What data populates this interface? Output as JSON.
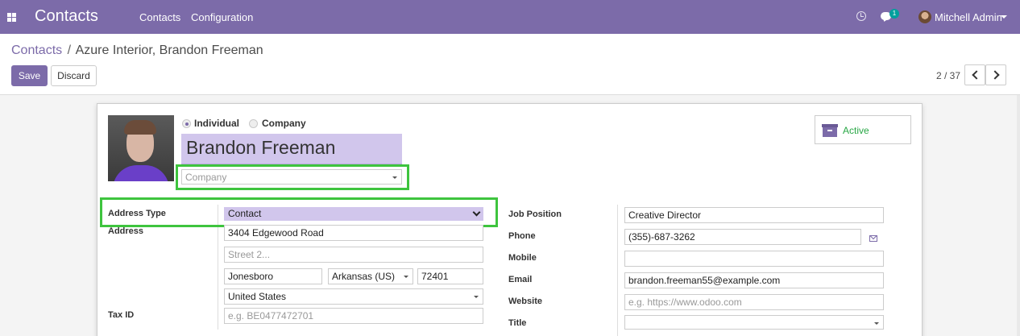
{
  "navbar": {
    "app_title": "Contacts",
    "menu": [
      "Contacts",
      "Configuration"
    ],
    "chat_badge": "1",
    "user": "Mitchell Admin"
  },
  "breadcrumb": {
    "root": "Contacts",
    "separator": "/",
    "current": "Azure Interior, Brandon Freeman"
  },
  "buttons": {
    "save": "Save",
    "discard": "Discard"
  },
  "pager": {
    "value": "2 / 37"
  },
  "form": {
    "type_options": {
      "individual": "Individual",
      "company": "Company",
      "selected": "Individual"
    },
    "name": "Brandon Freeman",
    "company_placeholder": "Company",
    "active_label": "Active",
    "left": {
      "address_type_label": "Address Type",
      "address_type_value": "Contact",
      "address_label": "Address",
      "street": "3404  Edgewood Road",
      "street2_placeholder": "Street 2...",
      "city": "Jonesboro",
      "state": "Arkansas (US)",
      "zip": "72401",
      "country": "United States",
      "tax_id_label": "Tax ID",
      "tax_id_placeholder": "e.g. BE0477472701"
    },
    "right": {
      "job_position_label": "Job Position",
      "job_position": "Creative Director",
      "phone_label": "Phone",
      "phone": "(355)-687-3262",
      "mobile_label": "Mobile",
      "mobile": "",
      "email_label": "Email",
      "email": "brandon.freeman55@example.com",
      "website_label": "Website",
      "website_placeholder": "e.g. https://www.odoo.com",
      "title_label": "Title",
      "title": ""
    }
  },
  "colors": {
    "brand": "#7c6ba9",
    "highlight": "#3ec43e",
    "active": "#28a745"
  }
}
